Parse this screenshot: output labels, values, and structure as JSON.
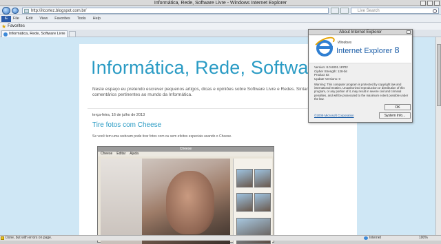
{
  "window": {
    "title": "Informática, Rede, Software Livre - Windows Internet Explorer"
  },
  "address": {
    "url": "http://itcortez.blogspot.com.br/",
    "search_placeholder": "Live Search"
  },
  "menu": {
    "items": [
      "File",
      "Edit",
      "View",
      "Favorites",
      "Tools",
      "Help"
    ],
    "logo": "IE"
  },
  "favorites": {
    "label": "Favorites"
  },
  "tabs": [
    {
      "label": "Informática, Rede, Software Livre"
    }
  ],
  "blog": {
    "title": "Informática, Rede, Software Livre",
    "description": "Neste espaço eu pretendo escrever pequenos artigos, dicas e opiniões sobre Software Livre e Redes. Sintam-se a vontade para comentários pertinentes ao mundo da Informática.",
    "post": {
      "date": "terça-feira, 16 de julho de 2013",
      "title": "Tire fotos com Cheese",
      "intro": "Se você tem uma webcam pode tirar fotos com ou sem efeitos especiais usando o Cheese."
    },
    "cheese": {
      "window_title": "Cheese",
      "menu": [
        "Cheese",
        "Editar",
        "Ajuda"
      ]
    }
  },
  "status": {
    "text": "Done, but with errors on page.",
    "zone": "Internet",
    "zoom": "100%"
  },
  "dialog": {
    "title": "About Internet Explorer",
    "windows_label": "Windows",
    "product": "Internet Explorer",
    "product_version": "8",
    "info": [
      "Version: 8.0.6001.18702",
      "Cipher Strength: 128-bit",
      "Product ID:",
      "Update Versions: 0"
    ],
    "warning": "Warning: This computer program is protected by copyright law and international treaties. Unauthorized reproduction or distribution of this program, or any portion of it, may result in severe civil and criminal penalties, and will be prosecuted to the maximum extent possible under the law.",
    "ok_label": "OK",
    "copyright": "©2009 Microsoft Corporation",
    "system_info_label": "System Info..."
  }
}
